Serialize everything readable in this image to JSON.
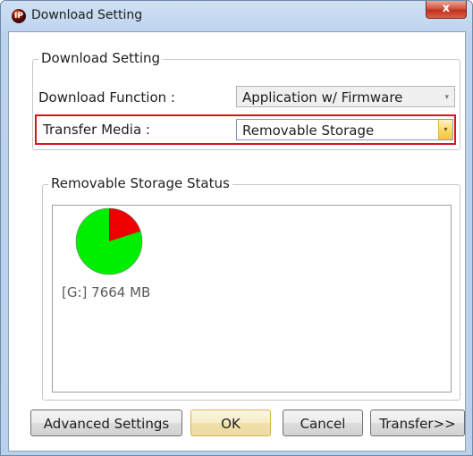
{
  "window": {
    "title": "Download Setting",
    "close_glyph": "x",
    "app_icon_glyph": "IP"
  },
  "download_group": {
    "label": "Download Setting",
    "function_label": "Download Function :",
    "function_value": "Application w/ Firmware",
    "media_label": "Transfer Media :",
    "media_value": "Removable Storage",
    "arrow_glyph": "▾"
  },
  "storage_group": {
    "label": "Removable Storage Status",
    "drive_text": "[G:] 7664 MB",
    "used_fraction": 0.2
  },
  "buttons": {
    "advanced": "Advanced Settings",
    "ok": "OK",
    "cancel": "Cancel",
    "transfer": "Transfer>>"
  },
  "colors": {
    "free": "#00ee00",
    "used": "#ee0000",
    "highlight": "#e0121b"
  }
}
